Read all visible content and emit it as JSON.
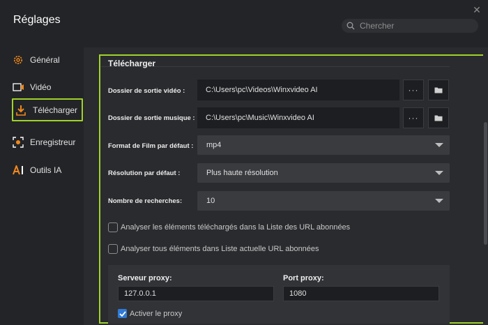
{
  "window": {
    "title": "Réglages",
    "close_symbol": "✕"
  },
  "search": {
    "placeholder": "Chercher"
  },
  "sidebar": {
    "items": [
      {
        "label": "Général",
        "icon": "gear-icon"
      },
      {
        "label": "Vidéo",
        "icon": "video-icon"
      },
      {
        "label": "Télécharger",
        "icon": "download-icon",
        "active": true
      },
      {
        "label": "Enregistreur",
        "icon": "record-icon"
      },
      {
        "label": "Outils IA",
        "icon": "ai-icon"
      }
    ]
  },
  "section": {
    "title": "Télécharger"
  },
  "fields": {
    "video_output": {
      "label": "Dossier de sortie vidéo :",
      "value": "C:\\Users\\pc\\Videos\\Winxvideo AI",
      "dots": "···"
    },
    "music_output": {
      "label": "Dossier de sortie musique :",
      "value": "C:\\Users\\pc\\Music\\Winxvideo AI",
      "dots": "···"
    },
    "default_format": {
      "label": "Format de Film par défaut :",
      "value": "mp4"
    },
    "default_resolution": {
      "label": "Résolution par défaut :",
      "value": "Plus haute résolution"
    },
    "search_count": {
      "label": "Nombre de recherches:",
      "value": "10"
    }
  },
  "checkboxes": {
    "analyze_downloaded": {
      "label": "Analyser les éléments téléchargés dans la Liste des URL abonnées",
      "checked": false
    },
    "analyze_all": {
      "label": "Analyser tous éléments dans Liste actuelle URL abonnées",
      "checked": false
    }
  },
  "proxy": {
    "server_label": "Serveur proxy:",
    "server_value": "127.0.0.1",
    "port_label": "Port proxy:",
    "port_value": "1080",
    "enable_label": "Activer le proxy",
    "enabled": true
  },
  "colors": {
    "highlight": "#9fd32a",
    "accent_orange": "#f0891c",
    "checkbox_blue": "#2f7ad6"
  }
}
